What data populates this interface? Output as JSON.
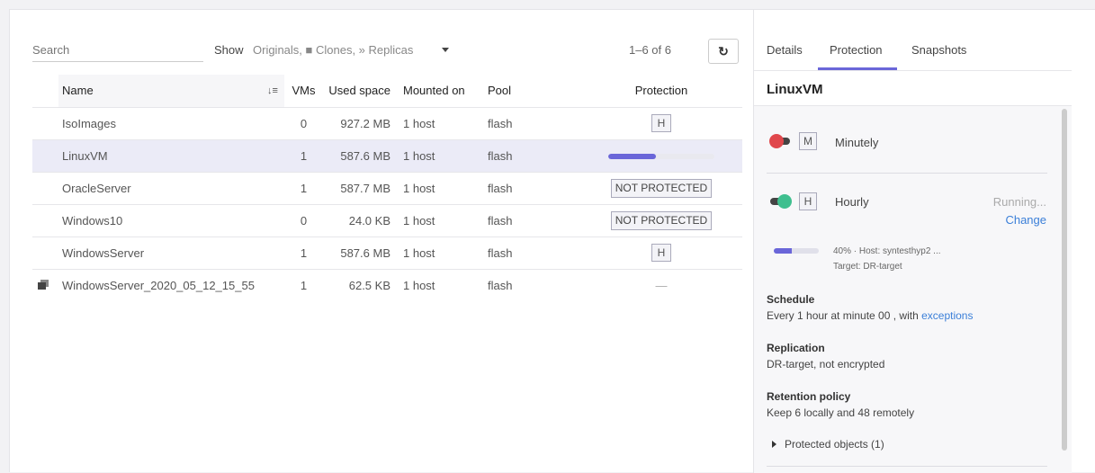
{
  "toolbar": {
    "search_placeholder": "Search",
    "show_label": "Show",
    "show_value": "Originals, ■ Clones, » Replicas",
    "pager": "1–6 of 6",
    "refresh_icon": "↻"
  },
  "table": {
    "headers": {
      "name": "Name",
      "sort_icon": "↓≡",
      "vms": "VMs",
      "used": "Used space",
      "mounted": "Mounted on",
      "pool": "Pool",
      "protection": "Protection"
    },
    "rows": [
      {
        "name": "IsoImages",
        "vms": "0",
        "used": "927.2 MB",
        "mounted": "1 host",
        "pool": "flash",
        "protection": "H"
      },
      {
        "name": "LinuxVM",
        "vms": "1",
        "used": "587.6 MB",
        "mounted": "1 host",
        "pool": "flash",
        "progress": 0.45
      },
      {
        "name": "OracleServer",
        "vms": "1",
        "used": "587.7 MB",
        "mounted": "1 host",
        "pool": "flash",
        "protection": "NOT PROTECTED"
      },
      {
        "name": "Windows10",
        "vms": "0",
        "used": "24.0 KB",
        "mounted": "1 host",
        "pool": "flash",
        "protection": "NOT PROTECTED"
      },
      {
        "name": "WindowsServer",
        "vms": "1",
        "used": "587.6 MB",
        "mounted": "1 host",
        "pool": "flash",
        "protection": "H"
      },
      {
        "name": "WindowsServer_2020_05_12_15_55",
        "vms": "1",
        "used": "62.5 KB",
        "mounted": "1 host",
        "pool": "flash",
        "protection": "—"
      }
    ]
  },
  "details": {
    "tabs": [
      "Details",
      "Protection",
      "Snapshots"
    ],
    "active_tab": "Protection",
    "title": "LinuxVM",
    "schedules": [
      {
        "badge": "M",
        "name": "Minutely",
        "toggle_color": "#e0474c",
        "enabled": false
      },
      {
        "badge": "H",
        "name": "Hourly",
        "status": "Running...",
        "action": "Change",
        "toggle_color": "#3fbf8f",
        "enabled": true
      }
    ],
    "progress": {
      "text": "40% · Host: syntesthyp2 ...",
      "target": "Target: DR-target",
      "value": 0.4
    },
    "schedule_label": "Schedule",
    "schedule_value": "Every 1 hour at minute 00 , with",
    "schedule_link": "exceptions",
    "replication_label": "Replication",
    "replication_value": "DR-target, not encrypted",
    "retention_label": "Retention policy",
    "retention_value": "Keep 6 locally and 48 remotely",
    "protected_objects": "Protected objects (1)"
  },
  "colors": {
    "accent": "#6a66d9",
    "link": "#3b7fd8",
    "selected_row": "#ebebf7"
  }
}
